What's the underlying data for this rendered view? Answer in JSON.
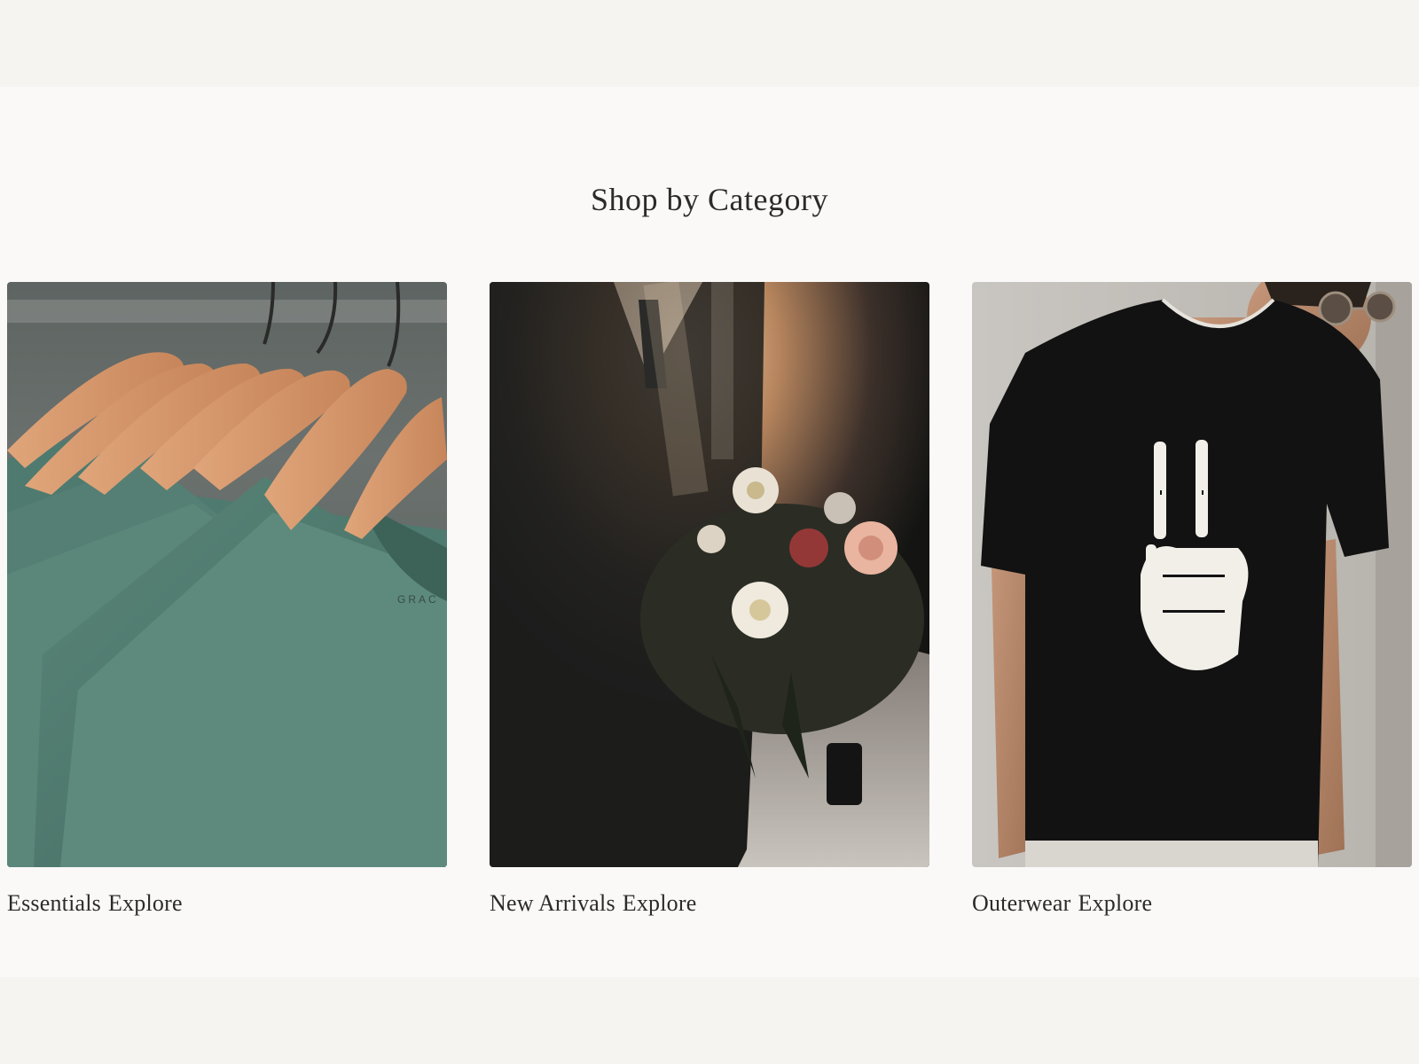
{
  "section": {
    "title": "Shop by Category"
  },
  "categories": [
    {
      "name": "Essentials",
      "link": "Explore",
      "image": "green-tshirts-on-hangers"
    },
    {
      "name": "New Arrivals",
      "link": "Explore",
      "image": "wedding-bouquet"
    },
    {
      "name": "Outerwear",
      "link": "Explore",
      "image": "skeleton-peace-tshirt"
    }
  ],
  "colors": {
    "page_bg": "#f5f4f1",
    "section_bg": "#faf9f7",
    "text": "#2b2b2b"
  }
}
